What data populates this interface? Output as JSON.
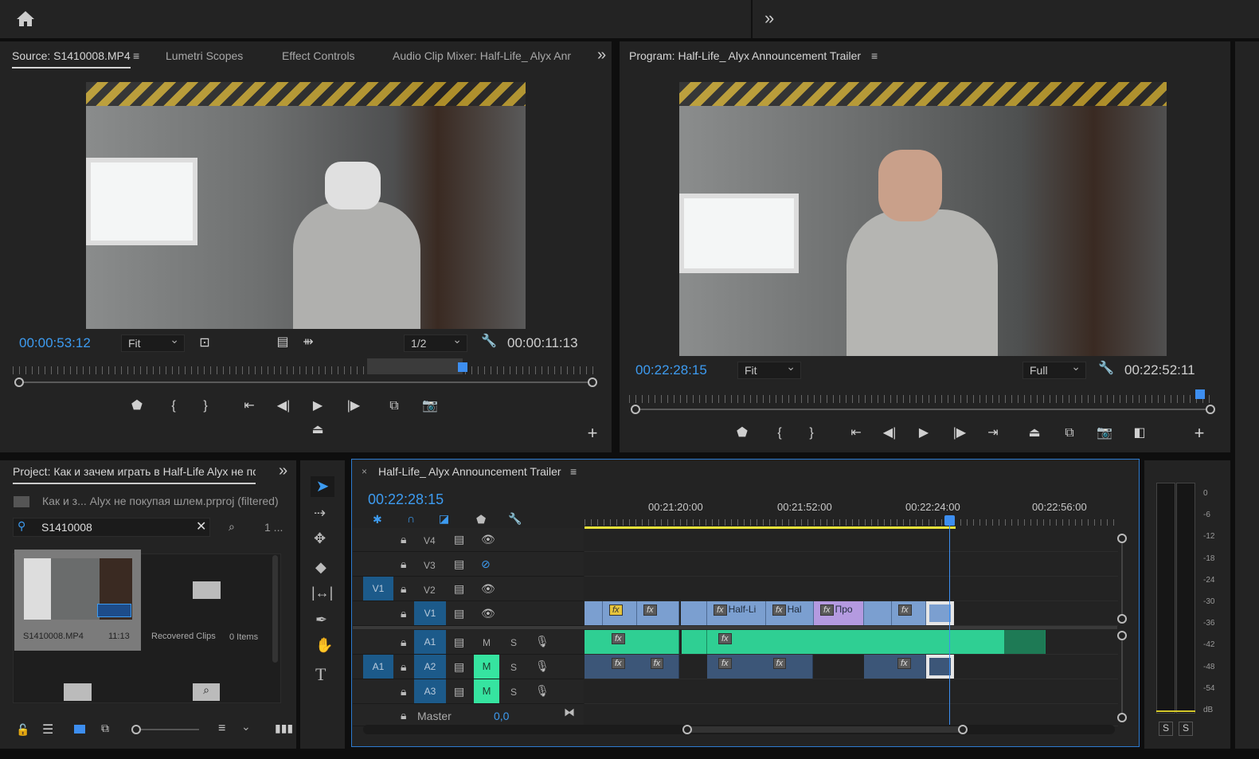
{
  "topbar": {
    "home_icon": "home-icon",
    "expand_icon": "double-chevron-right-icon",
    "expand": "»"
  },
  "source": {
    "tabs": [
      "Source: S1410008.MP4",
      "Lumetri Scopes",
      "Effect Controls",
      "Audio Clip Mixer: Half-Life_ Alyx Anr"
    ],
    "timecode": "00:00:53:12",
    "zoom": "Fit",
    "resolution": "1/2",
    "duration": "00:00:11:13",
    "playhead_fraction": 0.77
  },
  "program": {
    "title": "Program: Half-Life_ Alyx Announcement Trailer",
    "timecode": "00:22:28:15",
    "zoom": "Fit",
    "resolution": "Full",
    "duration": "00:22:52:11",
    "playhead_fraction": 0.98
  },
  "project": {
    "title": "Project: Как и зачем играть в Half-Life Alyx не пс",
    "path": "Как и з... Alyx не покупая шлем.prproj (filtered)",
    "search_value": "S1410008",
    "count": "1 ...",
    "items": [
      {
        "name": "S1410008.MP4",
        "duration": "11:13"
      },
      {
        "name": "Recovered Clips",
        "count": "0 Items"
      }
    ]
  },
  "timeline": {
    "title": "Half-Life_ Alyx Announcement Trailer",
    "timecode": "00:22:28:15",
    "ruler_labels": [
      "00:21:20:00",
      "00:21:52:00",
      "00:22:24:00",
      "00:22:56:00"
    ],
    "video_tracks": [
      {
        "name": "V4",
        "visible": true
      },
      {
        "name": "V3",
        "visible": false
      },
      {
        "name": "V2",
        "visible": true,
        "source_target": "V1"
      },
      {
        "name": "V1",
        "visible": true
      }
    ],
    "audio_tracks": [
      {
        "name": "A1",
        "m": "M",
        "s": "S"
      },
      {
        "name": "A2",
        "m": "M",
        "s": "S",
        "source_target": "A1",
        "muted": true
      },
      {
        "name": "A3",
        "m": "M",
        "s": "S",
        "muted": true
      }
    ],
    "master": {
      "label": "Master",
      "value": "0,0"
    },
    "clip_labels": [
      "Half-Li",
      "Hal",
      "Про"
    ],
    "fx": "fx"
  },
  "meter": {
    "scale": [
      "0",
      "-6",
      "-12",
      "-18",
      "-24",
      "-30",
      "-36",
      "-42",
      "-48",
      "-54",
      "dB"
    ],
    "solo": [
      "S",
      "S"
    ]
  },
  "colors": {
    "accent": "#3d9bf0",
    "audio_clip": "#2fcf93",
    "video_clip": "#7b9fd0",
    "adjust_clip": "#b49ae0",
    "mute_on": "#36e4a0",
    "work_area": "#e8e23a"
  }
}
